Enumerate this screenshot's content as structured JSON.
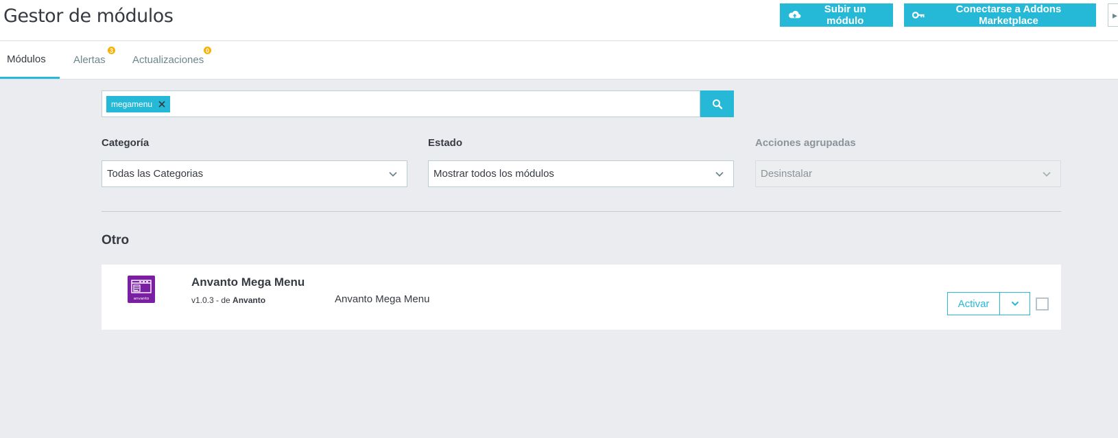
{
  "header": {
    "title": "Gestor de módulos",
    "upload_label": "Subir un módulo",
    "connect_label": "Conectarse a Addons Marketplace"
  },
  "tabs": [
    {
      "label": "Módulos",
      "active": true
    },
    {
      "label": "Alertas",
      "badge": "3"
    },
    {
      "label": "Actualizaciones",
      "badge": "0"
    }
  ],
  "search": {
    "tag": "megamenu"
  },
  "filters": {
    "category": {
      "label": "Categoría",
      "value": "Todas las Categorias"
    },
    "status": {
      "label": "Estado",
      "value": "Mostrar todos los módulos"
    },
    "bulk": {
      "label": "Acciones agrupadas",
      "value": "Desinstalar"
    }
  },
  "section": {
    "title": "Otro"
  },
  "module": {
    "name": "Anvanto Mega Menu",
    "version": "v1.0.3 - de",
    "author": "Anvanto",
    "description": "Anvanto Mega Menu",
    "activate_label": "Activar",
    "logo_text": "anvanto"
  },
  "colors": {
    "accent": "#25b9d7",
    "badge": "#fab000",
    "logo_bg": "#7b1fa2"
  }
}
